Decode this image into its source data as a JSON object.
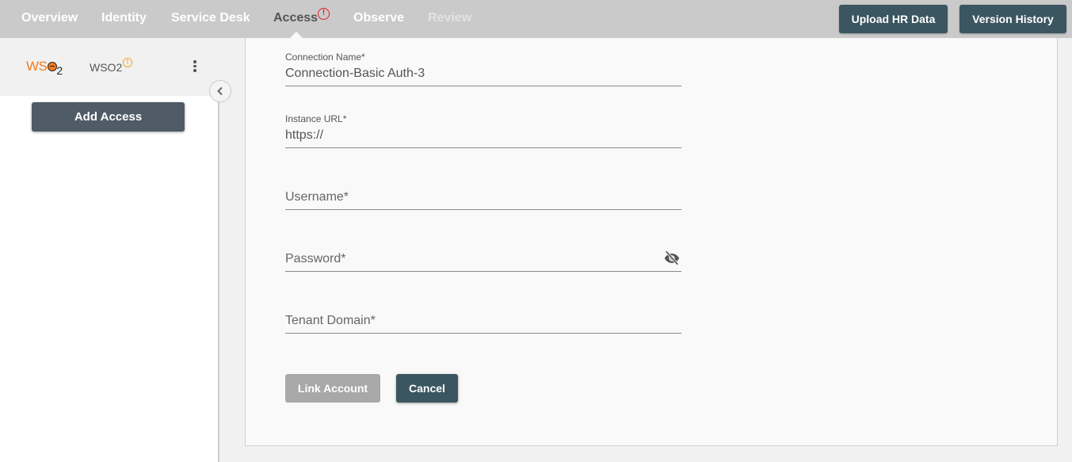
{
  "nav": {
    "tabs": [
      {
        "label": "Overview",
        "state": "normal"
      },
      {
        "label": "Identity",
        "state": "normal"
      },
      {
        "label": "Service Desk",
        "state": "normal"
      },
      {
        "label": "Access",
        "state": "active",
        "badge": "!"
      },
      {
        "label": "Observe",
        "state": "normal"
      },
      {
        "label": "Review",
        "state": "disabled"
      }
    ],
    "buttons": {
      "upload_hr_data": "Upload HR Data",
      "version_history": "Version History"
    }
  },
  "sidebar": {
    "logo": {
      "text": "WS",
      "subscript": "2"
    },
    "org_name": "WSO2",
    "org_badge": "!",
    "add_access_label": "Add Access"
  },
  "form": {
    "connection_name": {
      "label": "Connection Name*",
      "value": "Connection-Basic Auth-3"
    },
    "instance_url": {
      "label": "Instance URL*",
      "value": "https://"
    },
    "username": {
      "placeholder": "Username*",
      "value": ""
    },
    "password": {
      "placeholder": "Password*",
      "value": "",
      "visibility_icon": "eye-off-icon"
    },
    "tenant_domain": {
      "placeholder": "Tenant Domain*",
      "value": ""
    },
    "buttons": {
      "link_account": "Link Account",
      "cancel": "Cancel"
    }
  },
  "colors": {
    "nav_bg": "#cacaca",
    "primary_button": "#3b5660",
    "disabled_button": "#a8a8a8",
    "alert": "#e0211f",
    "warning": "#f5a623",
    "brand_orange": "#f47b20"
  }
}
